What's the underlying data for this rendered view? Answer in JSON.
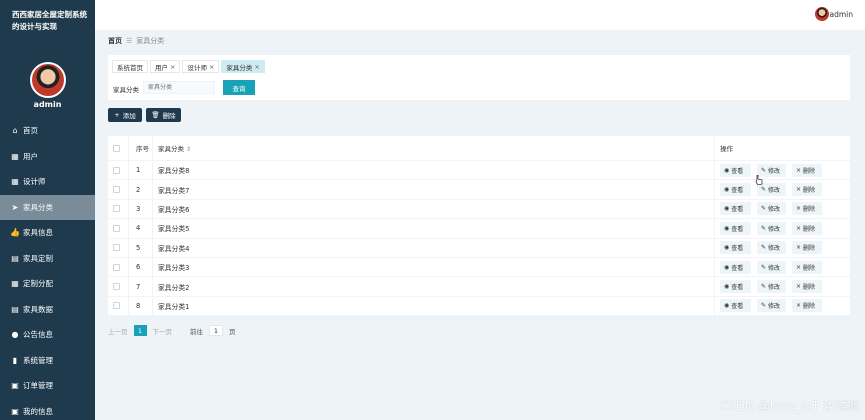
{
  "sidebar": {
    "system_title": "西西家居全屋定制系统的设计与实现",
    "username": "admin",
    "items": [
      {
        "label": "首页",
        "icon": "home-icon"
      },
      {
        "label": "用户",
        "icon": "grid-icon"
      },
      {
        "label": "设计师",
        "icon": "grid-icon"
      },
      {
        "label": "家具分类",
        "icon": "send-icon",
        "active": true
      },
      {
        "label": "家具信息",
        "icon": "thumbs-up-icon"
      },
      {
        "label": "家具定制",
        "icon": "chart-icon"
      },
      {
        "label": "定制分配",
        "icon": "table-icon"
      },
      {
        "label": "家具数据",
        "icon": "list-icon"
      },
      {
        "label": "公告信息",
        "icon": "location-icon"
      },
      {
        "label": "系统管理",
        "icon": "bar-chart-icon"
      },
      {
        "label": "订单管理",
        "icon": "clipboard-icon"
      },
      {
        "label": "我的信息",
        "icon": "user-card-icon"
      }
    ]
  },
  "topbar": {
    "username": "admin"
  },
  "breadcrumb": {
    "home": "首页",
    "current": "家具分类"
  },
  "tabs": [
    {
      "label": "系统首页",
      "closable": false
    },
    {
      "label": "用户",
      "closable": true
    },
    {
      "label": "设计师",
      "closable": true
    },
    {
      "label": "家具分类",
      "closable": true,
      "active": true
    }
  ],
  "search": {
    "label": "家具分类",
    "placeholder": "家具分类",
    "button": "查询"
  },
  "actions": {
    "add": "添加",
    "delete": "删除"
  },
  "table": {
    "headers": {
      "index": "序号",
      "name": "家具分类",
      "ops": "操作"
    },
    "rows": [
      {
        "index": "1",
        "name": "家具分类8"
      },
      {
        "index": "2",
        "name": "家具分类7"
      },
      {
        "index": "3",
        "name": "家具分类6"
      },
      {
        "index": "4",
        "name": "家具分类5"
      },
      {
        "index": "5",
        "name": "家具分类4"
      },
      {
        "index": "6",
        "name": "家具分类3"
      },
      {
        "index": "7",
        "name": "家具分类2"
      },
      {
        "index": "8",
        "name": "家具分类1"
      }
    ],
    "op_labels": {
      "view": "查看",
      "edit": "修改",
      "delete": "删除"
    }
  },
  "pagination": {
    "prev": "上一页",
    "current": "1",
    "next": "下一页",
    "goto": "前往",
    "page_input": "1",
    "unit": "页"
  },
  "watermark": "CSDN @Java_IoT 攻诚狮",
  "colors": {
    "sidebar": "#1f3a4d",
    "accent": "#17a2b8",
    "active_menu": "#7a8c99"
  }
}
